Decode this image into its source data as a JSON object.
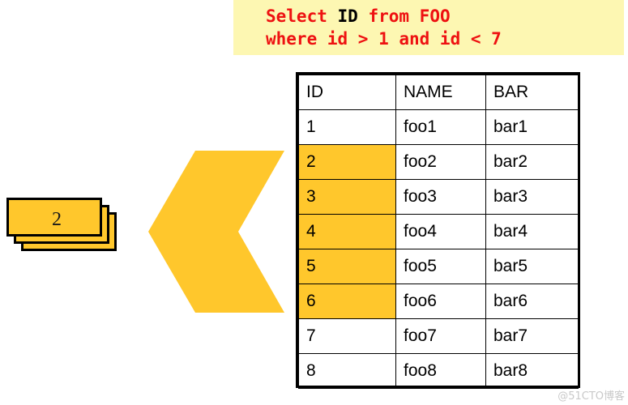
{
  "sql": {
    "line1_part1": "Select ",
    "line1_column": "ID",
    "line1_part2": " from FOO",
    "line2": "where id > 1 and id < 7",
    "text_color": "#ee1111",
    "column_color": "#000000",
    "background": "#fdf7b2"
  },
  "card_stack": {
    "front_label": "2",
    "card_count": 3,
    "fill_color": "#ffc72c",
    "border_color": "#000000"
  },
  "arrow": {
    "direction": "left",
    "shape": "chevron",
    "fill_color": "#ffc72c"
  },
  "table": {
    "columns": [
      "ID",
      "NAME",
      "BAR"
    ],
    "highlight_color": "#ffc72c",
    "rows": [
      {
        "id": "1",
        "name": "foo1",
        "bar": "bar1",
        "highlighted": false
      },
      {
        "id": "2",
        "name": "foo2",
        "bar": "bar2",
        "highlighted": true
      },
      {
        "id": "3",
        "name": "foo3",
        "bar": "bar3",
        "highlighted": true
      },
      {
        "id": "4",
        "name": "foo4",
        "bar": "bar4",
        "highlighted": true
      },
      {
        "id": "5",
        "name": "foo5",
        "bar": "bar5",
        "highlighted": true
      },
      {
        "id": "6",
        "name": "foo6",
        "bar": "bar6",
        "highlighted": true
      },
      {
        "id": "7",
        "name": "foo7",
        "bar": "bar7",
        "highlighted": false
      },
      {
        "id": "8",
        "name": "foo8",
        "bar": "bar8",
        "highlighted": false
      }
    ]
  },
  "watermark": {
    "text": "@51CTO博客"
  }
}
